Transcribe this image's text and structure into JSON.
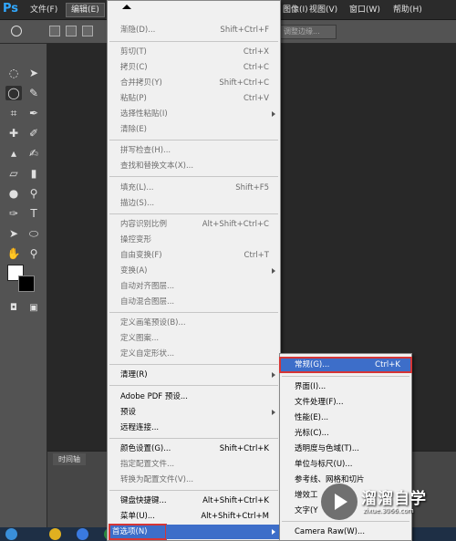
{
  "app": {
    "logo": "Ps",
    "brand_color": "#31a8ff"
  },
  "menubar": {
    "items": [
      {
        "label": "文件(F)"
      },
      {
        "label": "编辑(E)"
      },
      {
        "label": "图像(I)"
      },
      {
        "label": "视图(V)"
      },
      {
        "label": "窗口(W)"
      },
      {
        "label": "帮助(H)"
      }
    ]
  },
  "options_bar": {
    "refine_edge_label": "调整边缘..."
  },
  "timeline": {
    "tab_label": "时间轴"
  },
  "edit_menu": {
    "items": [
      {
        "label": "渐隐(D)...",
        "shortcut": "Shift+Ctrl+F",
        "disabled": true
      },
      {
        "label": "剪切(T)",
        "shortcut": "Ctrl+X",
        "disabled": true
      },
      {
        "label": "拷贝(C)",
        "shortcut": "Ctrl+C",
        "disabled": true
      },
      {
        "label": "合并拷贝(Y)",
        "shortcut": "Shift+Ctrl+C",
        "disabled": true
      },
      {
        "label": "粘贴(P)",
        "shortcut": "Ctrl+V",
        "disabled": true
      },
      {
        "label": "选择性粘贴(I)",
        "shortcut": "",
        "disabled": true,
        "submenu": true
      },
      {
        "label": "清除(E)",
        "shortcut": "",
        "disabled": true
      },
      {
        "label": "拼写检查(H)...",
        "shortcut": "",
        "disabled": true
      },
      {
        "label": "查找和替换文本(X)...",
        "shortcut": "",
        "disabled": true
      },
      {
        "label": "填充(L)...",
        "shortcut": "Shift+F5",
        "disabled": true
      },
      {
        "label": "描边(S)...",
        "shortcut": "",
        "disabled": true
      },
      {
        "label": "内容识别比例",
        "shortcut": "Alt+Shift+Ctrl+C",
        "disabled": true
      },
      {
        "label": "操控变形",
        "shortcut": "",
        "disabled": true
      },
      {
        "label": "自由变换(F)",
        "shortcut": "Ctrl+T",
        "disabled": true
      },
      {
        "label": "变换(A)",
        "shortcut": "",
        "disabled": true,
        "submenu": true
      },
      {
        "label": "自动对齐图层...",
        "shortcut": "",
        "disabled": true
      },
      {
        "label": "自动混合图层...",
        "shortcut": "",
        "disabled": true
      },
      {
        "label": "定义画笔预设(B)...",
        "shortcut": "",
        "disabled": true
      },
      {
        "label": "定义图案...",
        "shortcut": "",
        "disabled": true
      },
      {
        "label": "定义自定形状...",
        "shortcut": "",
        "disabled": true
      },
      {
        "label": "清理(R)",
        "shortcut": "",
        "disabled": false,
        "submenu": true
      },
      {
        "label": "Adobe PDF 预设...",
        "shortcut": "",
        "disabled": false
      },
      {
        "label": "预设",
        "shortcut": "",
        "disabled": false,
        "submenu": true
      },
      {
        "label": "远程连接...",
        "shortcut": "",
        "disabled": false
      },
      {
        "label": "颜色设置(G)...",
        "shortcut": "Shift+Ctrl+K",
        "disabled": false
      },
      {
        "label": "指定配置文件...",
        "shortcut": "",
        "disabled": true
      },
      {
        "label": "转换为配置文件(V)...",
        "shortcut": "",
        "disabled": true
      },
      {
        "label": "键盘快捷键...",
        "shortcut": "Alt+Shift+Ctrl+K",
        "disabled": false
      },
      {
        "label": "菜单(U)...",
        "shortcut": "Alt+Shift+Ctrl+M",
        "disabled": false
      },
      {
        "label": "首选项(N)",
        "shortcut": "",
        "disabled": false,
        "submenu": true,
        "highlighted": true
      }
    ]
  },
  "preferences_menu": {
    "items": [
      {
        "label": "常规(G)...",
        "shortcut": "Ctrl+K",
        "highlighted": true
      },
      {
        "label": "界面(I)..."
      },
      {
        "label": "文件处理(F)..."
      },
      {
        "label": "性能(E)..."
      },
      {
        "label": "光标(C)..."
      },
      {
        "label": "透明度与色域(T)..."
      },
      {
        "label": "单位与标尺(U)..."
      },
      {
        "label": "参考线、网格和切片"
      },
      {
        "label": "增效工"
      },
      {
        "label": "文字(Y"
      },
      {
        "label": "Camera Raw(W)..."
      }
    ]
  },
  "watermark": {
    "title": "溜溜自学",
    "url": "zixue.3066.com"
  },
  "colors": {
    "menu_highlight": "#3d6ec9",
    "callout_border": "#d63535"
  }
}
